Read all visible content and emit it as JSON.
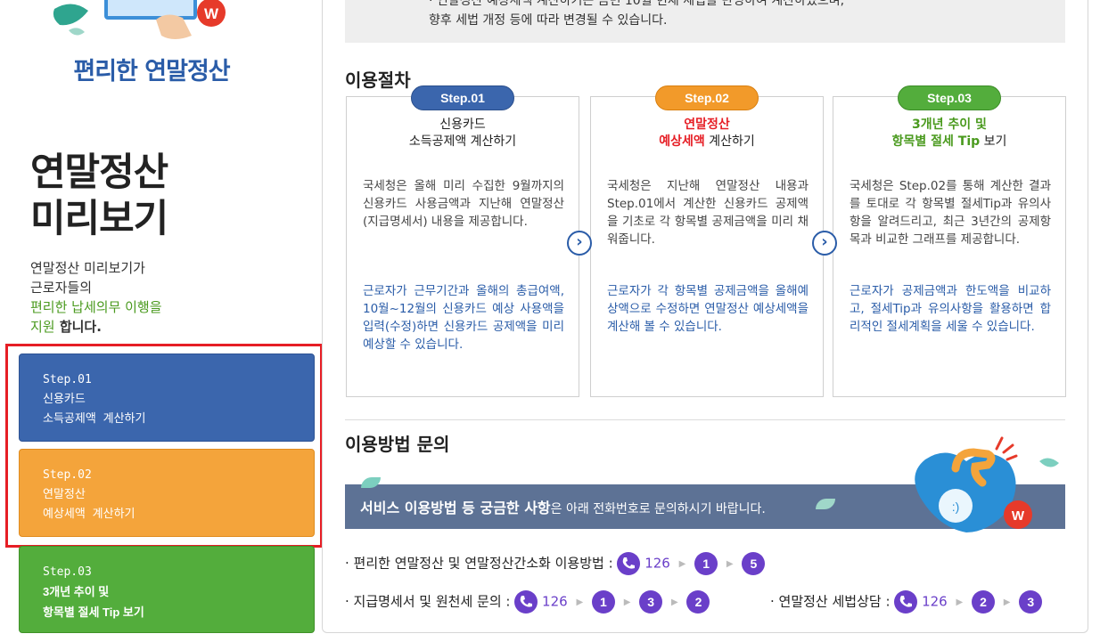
{
  "left": {
    "brand_title": "편리한 연말정산",
    "big_title_line1": "연말정산",
    "big_title_line2": "미리보기",
    "desc_line1": "연말정산 미리보기가",
    "desc_line2": "근로자들의",
    "desc_line3": "편리한 납세의무 이행을",
    "desc_line4_em": "지원",
    "desc_line4_rest": " 합니다.",
    "steps": [
      {
        "l1": "Step.01",
        "l2": "신용카드",
        "l3": "소득공제액 계산하기"
      },
      {
        "l1": "Step.02",
        "l2": "연말정산",
        "l3": "예상세액 계산하기"
      },
      {
        "l1": "Step.03",
        "l2": "3개년 추이 및",
        "l3": "항목별 절세 Tip 보기"
      }
    ]
  },
  "notice": {
    "line1": "· 연말정산 예상세액 계산하기는 금번 10월 현재 세법을 반영하여 계산하였으며,",
    "line2": "향후 세법 개정 등에 따라 변경될 수 있습니다."
  },
  "procedure": {
    "title": "이용절차",
    "cards": [
      {
        "pill": "Step.01",
        "title1": "신용카드",
        "title2": "소득공제액 계산하기",
        "body1": "국세청은 올해 미리 수집한 9월까지의 신용카드 사용금액과 지난해 연말정산(지급명세서) 내용을 제공합니다.",
        "body2": "근로자가 근무기간과 올해의 총급여액, 10월~12월의 신용카드 예상 사용액을 입력(수정)하면 신용카드 공제액을 미리 예상할 수 있습니다."
      },
      {
        "pill": "Step.02",
        "title1": "연말정산",
        "title2a": "예상세액",
        "title2b": " 계산하기",
        "body1": "국세청은 지난해 연말정산 내용과 Step.01에서 계산한 신용카드 공제액을 기초로 각 항목별 공제금액을 미리 채워줍니다.",
        "body2": "근로자가 각 항목별 공제금액을 올해예상액으로 수정하면 연말정산 예상세액을 계산해 볼 수 있습니다."
      },
      {
        "pill": "Step.03",
        "title1": "3개년 추이 및",
        "title2a": "항목별 ",
        "title2b": "절세 Tip",
        "title2c": " 보기",
        "body1": "국세청은 Step.02를 통해 계산한 결과를 토대로 각 항목별 절세Tip과 유의사항을 알려드리고, 최근 3년간의 공제항목과 비교한 그래프를 제공합니다.",
        "body2": "근로자가 공제금액과 한도액을 비교하고, 절세Tip과 유의사항을 활용하면 합리적인 절세계획을 세울 수 있습니다."
      }
    ],
    "arrow": "›"
  },
  "inquiry": {
    "title": "이용방법 문의",
    "banner_bold": "서비스 이용방법 등 궁금한 사항",
    "banner_rest": "은 아래 전화번호로 문의하시기 바랍니다.",
    "row1_label": "· 편리한 연말정산 및 연말정산간소화 이용방법 :",
    "row1_phone": "126",
    "row1_keys": [
      "1",
      "5"
    ],
    "row2_label": "· 지급명세서 및 원천세 문의 :",
    "row2_phone": "126",
    "row2_keys": [
      "1",
      "3",
      "2"
    ],
    "row3_label": "· 연말정산 세법상담 :",
    "row3_phone": "126",
    "row3_keys": [
      "2",
      "3"
    ]
  },
  "colors": {
    "step1": "#3b66ad",
    "step2": "#f29a2a",
    "step3": "#53ad3c",
    "highlight": "#e61e25",
    "phone_circle": "#6a3fc9",
    "banner": "#5d7295"
  }
}
